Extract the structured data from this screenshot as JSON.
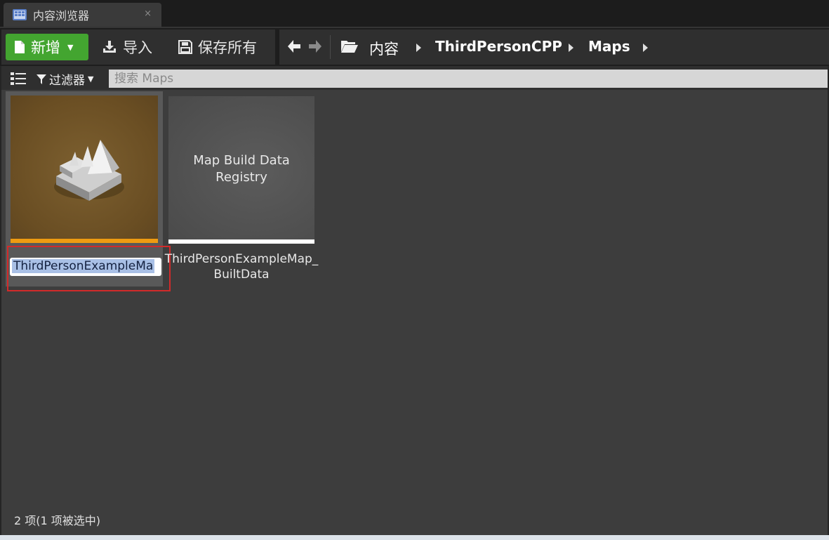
{
  "tab": {
    "label": "内容浏览器",
    "close": "×"
  },
  "toolbar": {
    "new_label": "新增",
    "import_label": "导入",
    "save_all_label": "保存所有"
  },
  "breadcrumb": [
    "内容",
    "ThirdPersonCPP",
    "Maps"
  ],
  "filterbar": {
    "filter_label": "过滤器",
    "search_placeholder": "搜索 Maps"
  },
  "assets": [
    {
      "name": "ThirdPersonExampleMa",
      "type_color": "#ee9b11",
      "selected": true,
      "renaming": true
    },
    {
      "thumb_label": "Map Build Data Registry",
      "name": "ThirdPersonExampleMap_\nBuiltData",
      "type_color": "#ffffff"
    }
  ],
  "status": {
    "text": "2 项(1 项被选中)"
  },
  "colors": {
    "accent_green": "#43a530",
    "selection_red": "#d12a2a"
  }
}
